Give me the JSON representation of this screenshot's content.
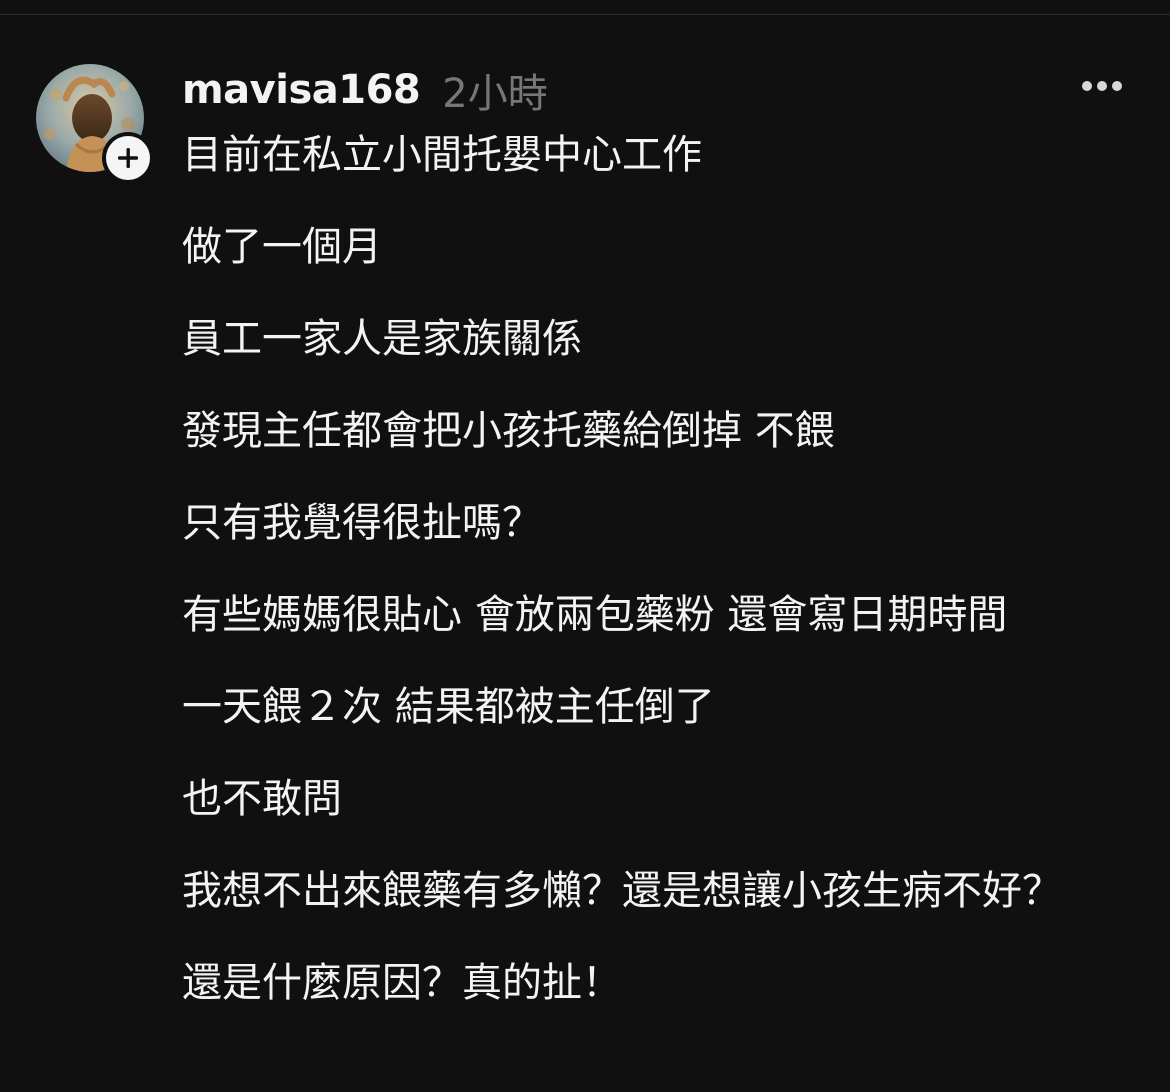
{
  "post": {
    "username": "mavisa168",
    "timestamp": "2小時",
    "lines": [
      "目前在私立小間托嬰中心工作",
      "做了一個月",
      "員工一家人是家族關係",
      "發現主任都會把小孩托藥給倒掉 不餵",
      "只有我覺得很扯嗎？",
      "有些媽媽很貼心 會放兩包藥粉 還會寫日期時間",
      "一天餵２次 結果都被主任倒了",
      "也不敢問",
      "我想不出來餵藥有多懶？還是想讓小孩生病不好？",
      "還是什麼原因？真的扯！"
    ]
  },
  "icons": {
    "follow": "plus-icon",
    "more": "more-horizontal-icon"
  },
  "colors": {
    "background": "#101010",
    "text": "#f3f3f3",
    "muted": "#777777",
    "badge": "#f5f5f5"
  }
}
